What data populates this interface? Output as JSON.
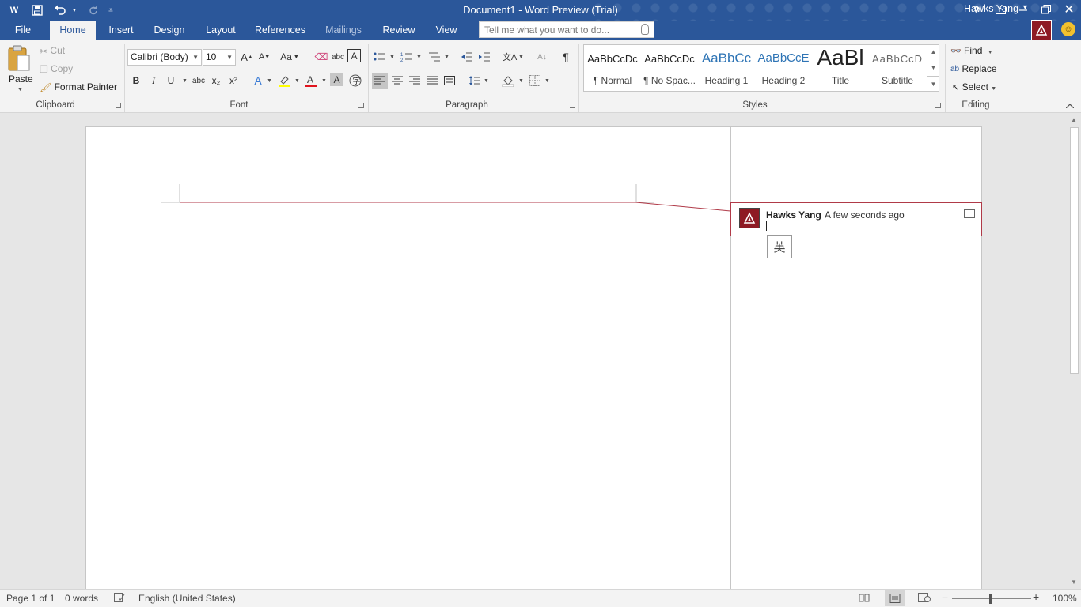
{
  "window": {
    "title": "Document1 - Word Preview (Trial)"
  },
  "tabs": [
    "File",
    "Home",
    "Insert",
    "Design",
    "Layout",
    "References",
    "Mailings",
    "Review",
    "View"
  ],
  "tellme_placeholder": "Tell me what you want to do...",
  "user": {
    "name": "Hawks Yang"
  },
  "clipboard": {
    "paste": "Paste",
    "cut": "Cut",
    "copy": "Copy",
    "format_painter": "Format Painter",
    "label": "Clipboard"
  },
  "font": {
    "name": "Calibri (Body)",
    "size": "10",
    "change_case": "Aa",
    "bold": "B",
    "italic": "I",
    "underline": "U",
    "strikethrough": "abc",
    "subscript": "x₂",
    "superscript": "x²",
    "label": "Font"
  },
  "paragraph": {
    "label": "Paragraph",
    "pilcrow": "¶"
  },
  "styles": {
    "items": [
      {
        "sample": "AaBbCcDc",
        "name": "¶ Normal"
      },
      {
        "sample": "AaBbCcDc",
        "name": "¶ No Spac..."
      },
      {
        "sample": "AaBbCc",
        "name": "Heading 1"
      },
      {
        "sample": "AaBbCcE",
        "name": "Heading 2"
      },
      {
        "sample": "AaBl",
        "name": "Title"
      },
      {
        "sample": "AaBbCcD",
        "name": "Subtitle"
      }
    ],
    "label": "Styles"
  },
  "editing": {
    "find": "Find",
    "replace": "Replace",
    "select": "Select",
    "label": "Editing"
  },
  "comment": {
    "author": "Hawks Yang",
    "time": "A few seconds ago",
    "ime": "英"
  },
  "status": {
    "page": "Page 1 of 1",
    "words": "0 words",
    "language": "English (United States)",
    "zoom": "100%"
  },
  "colors": {
    "accent": "#2b579a",
    "comment_border": "#b03a48",
    "avatar": "#8e1a23"
  }
}
